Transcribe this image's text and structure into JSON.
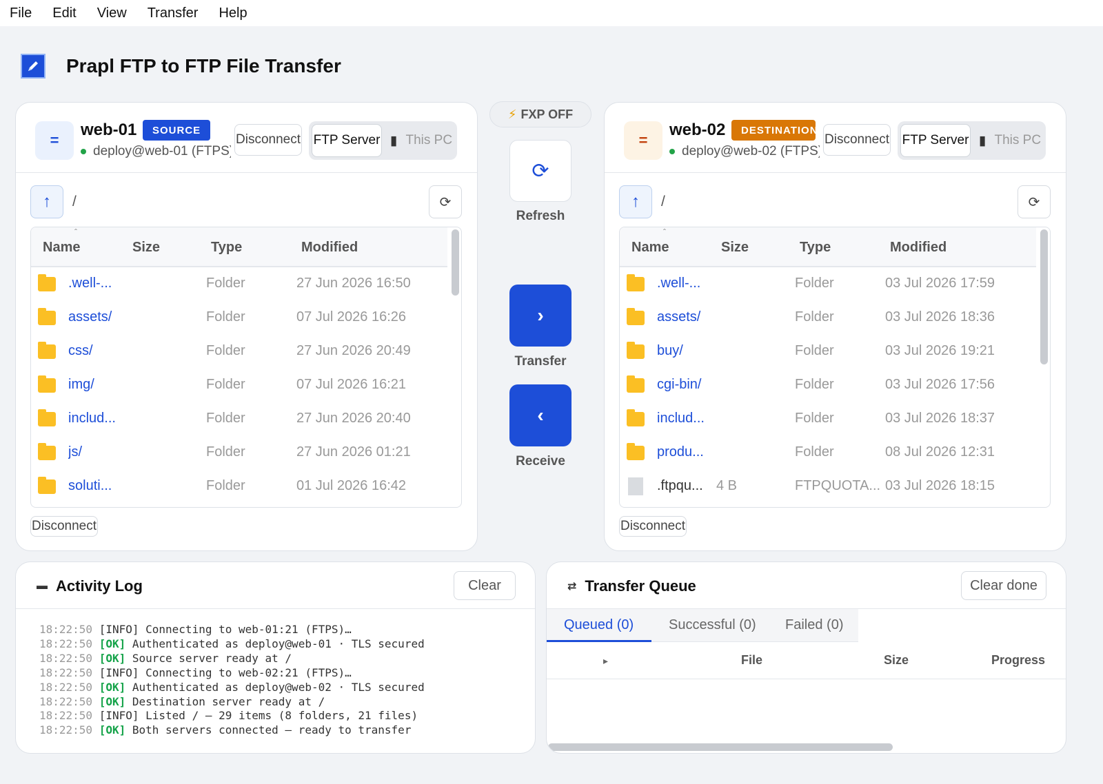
{
  "menu": [
    "File",
    "Edit",
    "View",
    "Transfer",
    "Help"
  ],
  "app": {
    "title": "Prapl FTP to FTP File Transfer",
    "logo_icon": "pen-icon"
  },
  "columns": {
    "name": "Name",
    "size": "Size",
    "type": "Type",
    "modified": "Modified",
    "sort_indicator": "ˆ"
  },
  "source": {
    "name": "web-01",
    "badge": "SOURCE",
    "user": "deploy@web-01  (FTPS)",
    "icon_glyph": "=",
    "disconnect_label": "Disconnect",
    "seg_active": "FTP Server",
    "seg_inactive": "This PC",
    "path": "/",
    "bottom_disconnect": "Disconnect",
    "files": [
      {
        "name": ".well-...",
        "size": "",
        "type": "Folder",
        "modified": "27 Jun 2026  16:50",
        "kind": "folder"
      },
      {
        "name": "assets/",
        "size": "",
        "type": "Folder",
        "modified": "07 Jul 2026  16:26",
        "kind": "folder"
      },
      {
        "name": "css/",
        "size": "",
        "type": "Folder",
        "modified": "27 Jun 2026  20:49",
        "kind": "folder"
      },
      {
        "name": "img/",
        "size": "",
        "type": "Folder",
        "modified": "07 Jul 2026  16:21",
        "kind": "folder"
      },
      {
        "name": "includ...",
        "size": "",
        "type": "Folder",
        "modified": "27 Jun 2026  20:40",
        "kind": "folder"
      },
      {
        "name": "js/",
        "size": "",
        "type": "Folder",
        "modified": "27 Jun 2026  01:21",
        "kind": "folder"
      },
      {
        "name": "soluti...",
        "size": "",
        "type": "Folder",
        "modified": "01 Jul 2026  16:42",
        "kind": "folder"
      }
    ]
  },
  "destination": {
    "name": "web-02",
    "badge": "DESTINATION",
    "user": "deploy@web-02  (FTPS)",
    "icon_glyph": "=",
    "disconnect_label": "Disconnect",
    "seg_active": "FTP Server",
    "seg_inactive": "This PC",
    "path": "/",
    "bottom_disconnect": "Disconnect",
    "files": [
      {
        "name": ".well-...",
        "size": "",
        "type": "Folder",
        "modified": "03 Jul 2026  17:59",
        "kind": "folder"
      },
      {
        "name": "assets/",
        "size": "",
        "type": "Folder",
        "modified": "03 Jul 2026  18:36",
        "kind": "folder"
      },
      {
        "name": "buy/",
        "size": "",
        "type": "Folder",
        "modified": "03 Jul 2026  19:21",
        "kind": "folder"
      },
      {
        "name": "cgi-bin/",
        "size": "",
        "type": "Folder",
        "modified": "03 Jul 2026  17:56",
        "kind": "folder"
      },
      {
        "name": "includ...",
        "size": "",
        "type": "Folder",
        "modified": "03 Jul 2026  18:37",
        "kind": "folder"
      },
      {
        "name": "produ...",
        "size": "",
        "type": "Folder",
        "modified": "08 Jul 2026  12:31",
        "kind": "folder"
      },
      {
        "name": ".ftpqu...",
        "size": "4 B",
        "type": "FTPQUOTA...",
        "modified": "03 Jul 2026  18:15",
        "kind": "file"
      }
    ]
  },
  "middle": {
    "fxp_label": "FXP OFF",
    "refresh_label": "Refresh",
    "transfer_label": "Transfer",
    "receive_label": "Receive",
    "transfer_glyph": "›",
    "receive_glyph": "‹"
  },
  "log": {
    "title": "Activity Log",
    "clear_label": "Clear",
    "entries": [
      {
        "time": "18:22:50",
        "level": "[INFO]",
        "msg": " Connecting to web-01:21 (FTPS)…"
      },
      {
        "time": "18:22:50",
        "level": "[OK]",
        "msg": " Authenticated as deploy@web-01 · TLS secured"
      },
      {
        "time": "18:22:50",
        "level": "[OK]",
        "msg": " Source server ready at /"
      },
      {
        "time": "18:22:50",
        "level": "[INFO]",
        "msg": " Connecting to web-02:21 (FTPS)…"
      },
      {
        "time": "18:22:50",
        "level": "[OK]",
        "msg": " Authenticated as deploy@web-02 · TLS secured"
      },
      {
        "time": "18:22:50",
        "level": "[OK]",
        "msg": " Destination server ready at /"
      },
      {
        "time": "18:22:50",
        "level": "[INFO]",
        "msg": " Listed / — 29 items (8 folders, 21 files)"
      },
      {
        "time": "18:22:50",
        "level": "[OK]",
        "msg": " Both servers connected — ready to transfer"
      }
    ]
  },
  "queue": {
    "title": "Transfer Queue",
    "clear_label": "Clear done",
    "tabs": [
      "Queued  (0)",
      "Successful  (0)",
      "Failed  (0)"
    ],
    "columns": {
      "expand": "▸",
      "file": "File",
      "size": "Size",
      "progress": "Progress"
    }
  },
  "colors": {
    "accent": "#1d4ed8",
    "destination": "#d97706",
    "ok": "#16a34a",
    "folder": "#fbbf24"
  }
}
